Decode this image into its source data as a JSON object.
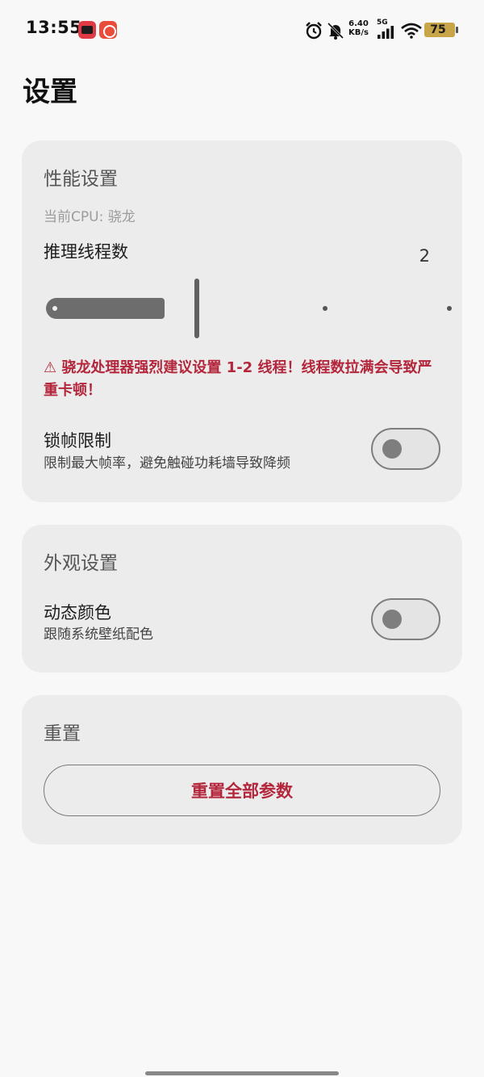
{
  "status_bar": {
    "time": "13:55",
    "net_speed_value": "6.40",
    "net_speed_unit": "KB/s",
    "network": "5G",
    "battery": "75",
    "icons": [
      "alarm-icon",
      "mute-icon",
      "signal-icon",
      "wifi-icon",
      "battery-icon"
    ]
  },
  "page": {
    "title": "设置"
  },
  "performance": {
    "title": "性能设置",
    "cpu_info": "当前CPU: 骁龙",
    "threads_label": "推理线程数",
    "threads_value": "2",
    "threads_level": 2,
    "warning": "⚠ 骁龙处理器强烈建议设置 1-2 线程！线程数拉满会导致严重卡顿！",
    "frame_lock_label": "锁帧限制",
    "frame_lock_desc": "限制最大帧率，避免触碰功耗墙导致降频",
    "frame_lock_on": false
  },
  "appearance": {
    "title": "外观设置",
    "dynamic_color_label": "动态颜色",
    "dynamic_color_desc": "跟随系统壁纸配色",
    "dynamic_color_on": false
  },
  "reset": {
    "title": "重置",
    "button_label": "重置全部参数"
  },
  "colors": {
    "accent_warning": "#b3263b",
    "card_bg": "#ececec",
    "battery": "#c9a54a"
  }
}
